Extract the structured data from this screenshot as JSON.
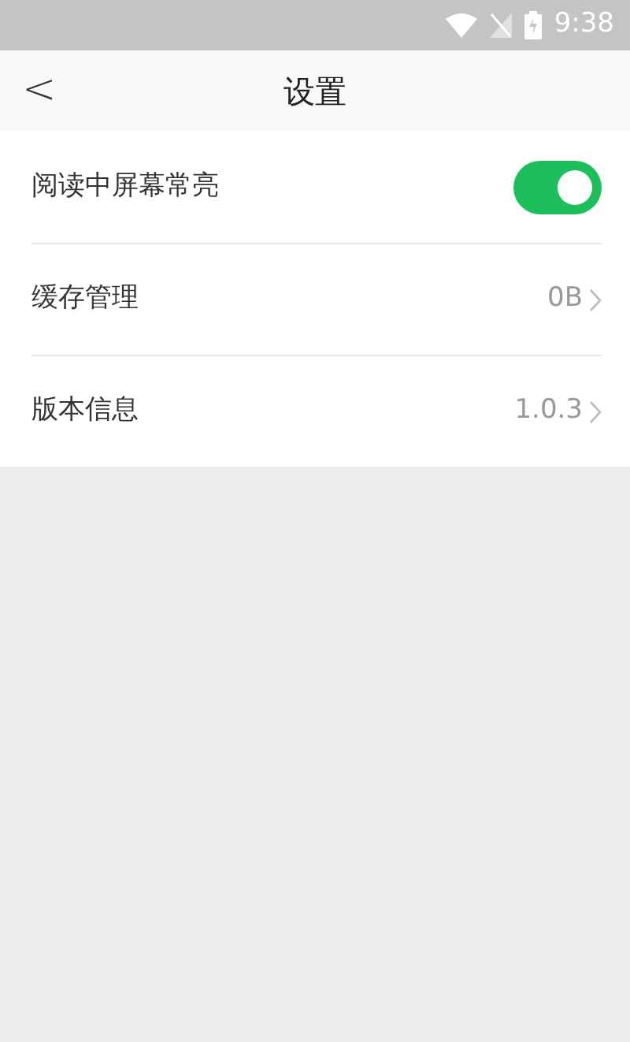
{
  "status_bar": {
    "time": "9:38"
  },
  "header": {
    "back": "<",
    "title": "设置"
  },
  "settings": [
    {
      "kind": "toggle",
      "label": "阅读中屏幕常亮",
      "on": true
    },
    {
      "kind": "link",
      "label": "缓存管理",
      "value": "0B"
    },
    {
      "kind": "link",
      "label": "版本信息",
      "value": "1.0.3"
    }
  ]
}
